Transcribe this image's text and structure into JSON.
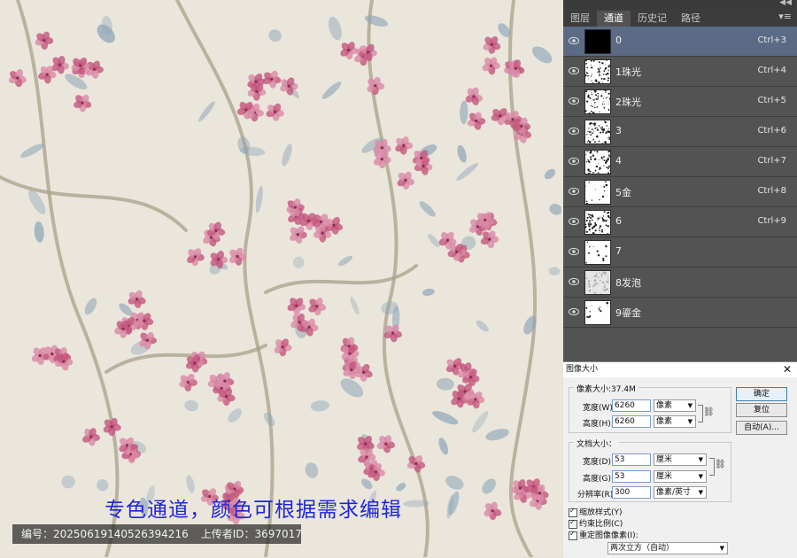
{
  "artwork": {
    "caption": "专色通道，颜色可根据需求编辑",
    "id_label": "编号：",
    "id_value": "20250619140526394216",
    "uploader_label": "上传者ID：",
    "uploader_value": "3697017",
    "colors": {
      "background": "#ebe6dc",
      "petal": "#d98aa6",
      "petal_dark": "#c4567e",
      "leaf": "#8ea6b8",
      "branch": "#a7a08a",
      "caption": "#1e27d6"
    }
  },
  "channels_panel": {
    "tabs": [
      {
        "label": "图层",
        "active": false
      },
      {
        "label": "通道",
        "active": true
      },
      {
        "label": "历史记",
        "active": false
      },
      {
        "label": "路径",
        "active": false
      }
    ],
    "channels": [
      {
        "name": "0",
        "shortcut": "Ctrl+3",
        "selected": true,
        "thumb": "black"
      },
      {
        "name": "1珠光",
        "shortcut": "Ctrl+4",
        "selected": false,
        "thumb": "speckle"
      },
      {
        "name": "2珠光",
        "shortcut": "Ctrl+5",
        "selected": false,
        "thumb": "speckle"
      },
      {
        "name": "3",
        "shortcut": "Ctrl+6",
        "selected": false,
        "thumb": "speckle"
      },
      {
        "name": "4",
        "shortcut": "Ctrl+7",
        "selected": false,
        "thumb": "speckle"
      },
      {
        "name": "5金",
        "shortcut": "Ctrl+8",
        "selected": false,
        "thumb": "light"
      },
      {
        "name": "6",
        "shortcut": "Ctrl+9",
        "selected": false,
        "thumb": "speckle"
      },
      {
        "name": "7",
        "shortcut": "",
        "selected": false,
        "thumb": "light"
      },
      {
        "name": "8发泡",
        "shortcut": "",
        "selected": false,
        "thumb": "grey"
      },
      {
        "name": "9鎏金",
        "shortcut": "",
        "selected": false,
        "thumb": "light"
      }
    ],
    "colors": {
      "panel": "#535353",
      "selected": "#5b6b86"
    }
  },
  "image_size_dialog": {
    "title": "图像大小",
    "pixel_group_title": "像素大小:37.4M",
    "width_label": "宽度(W):",
    "width_value": "6260",
    "width_unit": "像素",
    "height_label": "高度(H):",
    "height_value": "6260",
    "height_unit": "像素",
    "doc_group_title": "文档大小：",
    "doc_width_label": "宽度(D):",
    "doc_width_value": "53",
    "doc_width_unit": "厘米",
    "doc_height_label": "高度(G):",
    "doc_height_value": "53",
    "doc_height_unit": "厘米",
    "resolution_label": "分辨率(R):",
    "resolution_value": "300",
    "resolution_unit": "像素/英寸",
    "ok_label": "确定",
    "reset_label": "复位",
    "auto_label": "自动(A)...",
    "scale_styles_label": "缩放样式(Y)",
    "constrain_label": "约束比例(C)",
    "resample_label": "重定图像像素(I):",
    "resample_method": "两次立方（自动）"
  }
}
